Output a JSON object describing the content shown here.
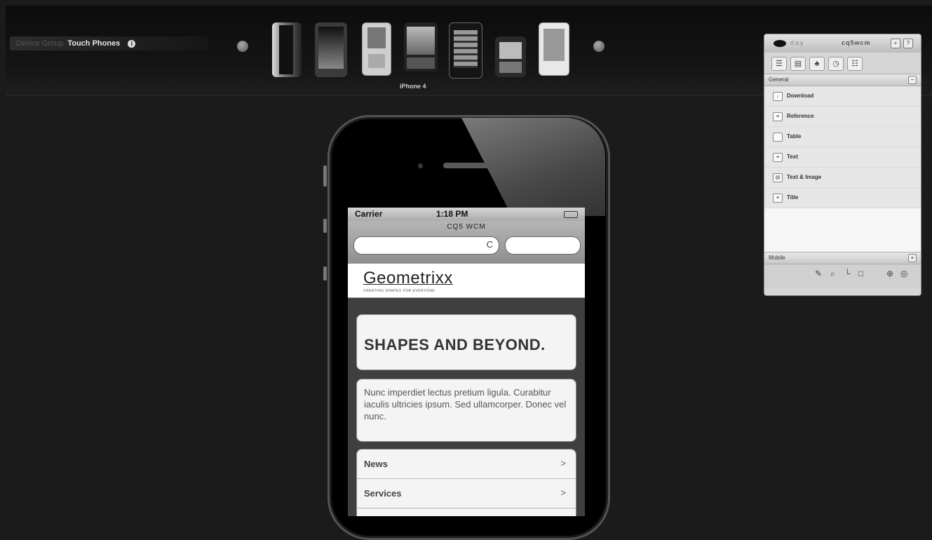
{
  "device_bar": {
    "group_label": "Device Group",
    "group_value": "Touch Phones",
    "info_icon": "info-icon",
    "selected_device": "iPhone 4",
    "devices": [
      "device-1",
      "device-2",
      "device-3",
      "device-4",
      "device-5",
      "device-6",
      "device-7"
    ]
  },
  "phone": {
    "status": {
      "carrier": "Carrier",
      "time": "1:18 PM"
    },
    "browser_title": "CQ5 WCM",
    "reload_icon": "C",
    "logo": "Geometrixx",
    "tagline": "CREATING SHAPES FOR EVERYONE",
    "hero": "SHAPES AND BEYOND.",
    "blurb": "Nunc imperdiet lectus pretium ligula. Curabitur iaculis ultricies ipsum. Sed ullamcorper. Donec vel nunc.",
    "menu": [
      {
        "label": "News",
        "chevron": ">"
      },
      {
        "label": "Services",
        "chevron": ">"
      },
      {
        "label": "",
        "chevron": ""
      }
    ]
  },
  "sidekick": {
    "title_left": "day",
    "title_right": "cq5wcm",
    "controls": [
      "+",
      "?"
    ],
    "tabs": [
      "☰",
      "▤",
      "♣",
      "◷",
      "☷"
    ],
    "section_general": "General",
    "items": [
      {
        "label": "Download",
        "icon": "download-icon"
      },
      {
        "label": "Reference",
        "icon": "reference-icon"
      },
      {
        "label": "Table",
        "icon": "table-icon"
      },
      {
        "label": "Text",
        "icon": "text-icon"
      },
      {
        "label": "Text & Image",
        "icon": "text-image-icon"
      },
      {
        "label": "Title",
        "icon": "title-icon"
      }
    ],
    "section_mobile": "Mobile",
    "bottom_icons": [
      "✎",
      "⌕",
      "└",
      "□",
      "⊕",
      "◎"
    ]
  }
}
